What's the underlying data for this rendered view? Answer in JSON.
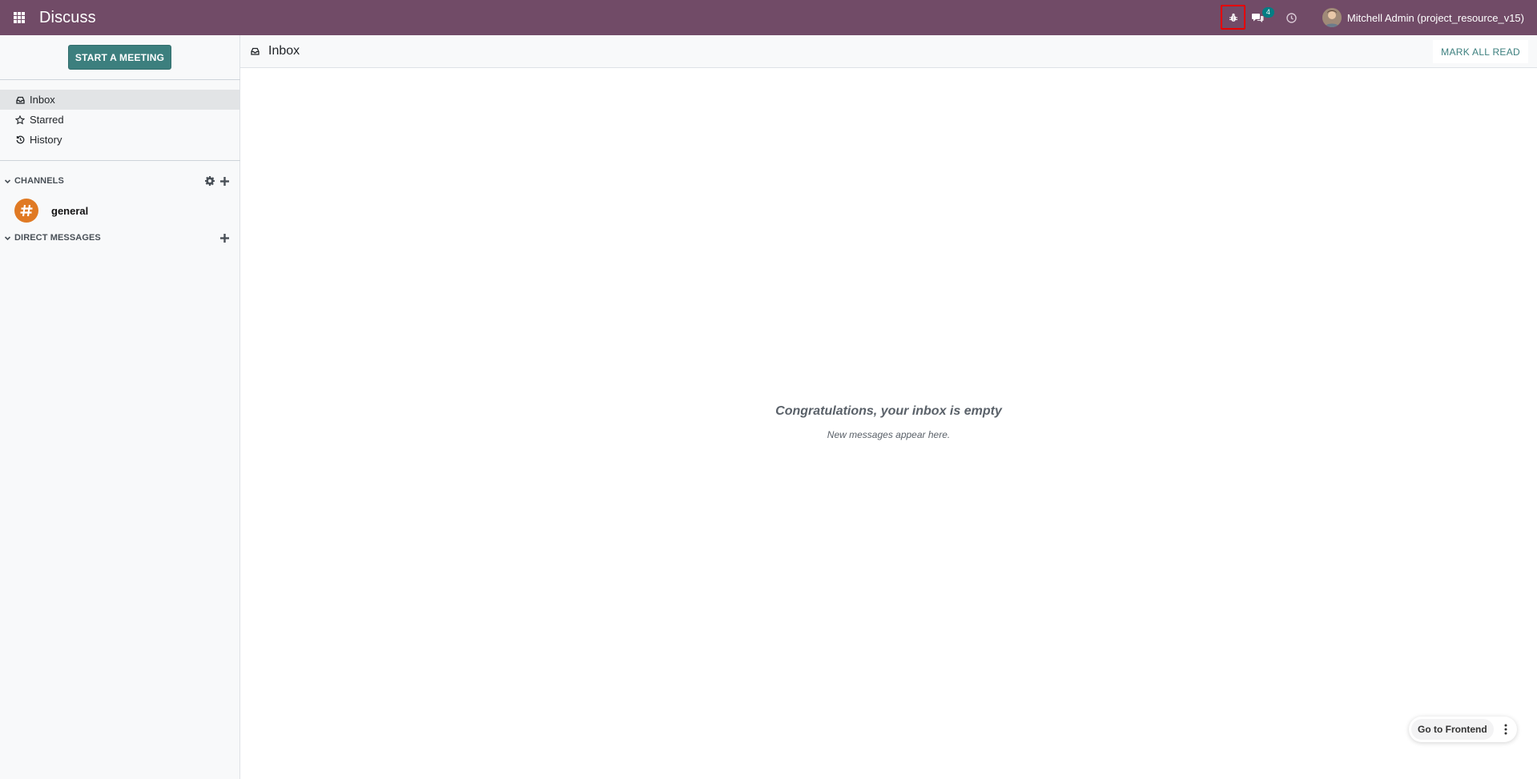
{
  "navbar": {
    "app_title": "Discuss",
    "message_count": "4",
    "user_name": "Mitchell Admin (project_resource_v15)",
    "bg_color": "#714b67"
  },
  "sidebar": {
    "start_meeting_label": "START A MEETING",
    "mailboxes": [
      {
        "label": "Inbox",
        "icon": "inbox-icon",
        "active": true
      },
      {
        "label": "Starred",
        "icon": "star-icon",
        "active": false
      },
      {
        "label": "History",
        "icon": "history-icon",
        "active": false
      }
    ],
    "channels_label": "CHANNELS",
    "channels": [
      {
        "name": "general",
        "icon": "hash-icon"
      }
    ],
    "direct_messages_label": "DIRECT MESSAGES"
  },
  "thread": {
    "title": "Inbox",
    "mark_all_read_label": "MARK ALL READ",
    "empty_title": "Congratulations, your inbox is empty",
    "empty_subtitle": "New messages appear here."
  },
  "frontend": {
    "label": "Go to Frontend"
  }
}
